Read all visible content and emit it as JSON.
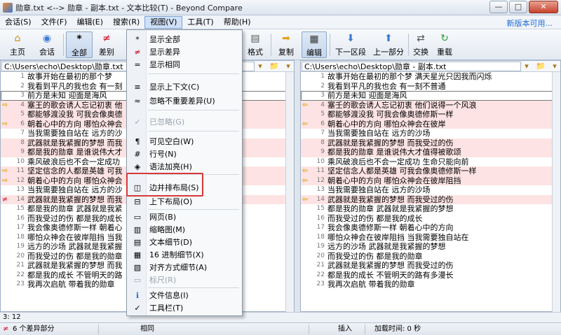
{
  "window": {
    "title": "勋章.txt <--> 勋章 - 副本.txt - 文本比较(T) - Beyond Compare",
    "min": "—",
    "max": "□",
    "close": "✕"
  },
  "menubar": {
    "items": [
      "会话(S)",
      "文件(F)",
      "编辑(E)",
      "搜索(R)",
      "视图(V)",
      "工具(T)",
      "帮助(H)"
    ],
    "new_version": "新版本可用..."
  },
  "toolbar": {
    "home": "主页",
    "session": "会话",
    "all": "全部",
    "diff": "差别",
    "format": "格式",
    "copy": "复制",
    "edit": "编辑",
    "next_section": "下一区段",
    "prev_part": "上一部分",
    "swap": "交换",
    "reload": "重载"
  },
  "left": {
    "path": "C:\\Users\\echo\\Desktop\\勋章.txt",
    "lines": [
      {
        "n": "1",
        "t": "故事开始在最初的那个梦",
        "g": "",
        "d": false
      },
      {
        "n": "2",
        "t": "我看到平凡的我也会  有一刻",
        "g": "",
        "d": false
      },
      {
        "n": "3",
        "t": "前方是未知  迎面是海风",
        "g": "",
        "d": false,
        "cur": true
      },
      {
        "n": "4",
        "t": "塞王的歌会诱人忘记初衷  他",
        "g": "⇨",
        "d": true
      },
      {
        "n": "5",
        "t": "都能够渡没我  可我会像奥德",
        "g": "",
        "d": true
      },
      {
        "n": "6",
        "t": "朝着心中的方向  哪怕众神会",
        "g": "⇨",
        "d": true
      },
      {
        "n": "7",
        "t": "当我需要独自站在  远方的沙",
        "g": "",
        "d": false
      },
      {
        "n": "8",
        "t": "武器就是我紧握的梦想  而我",
        "g": "",
        "d": true
      },
      {
        "n": "9",
        "t": "都是我的勋章  是谁说伟大才",
        "g": "",
        "d": true
      },
      {
        "n": "10",
        "t": "乘风破浪后也不会一定成功",
        "g": "",
        "d": false
      },
      {
        "n": "11",
        "t": "坚定信念的人都是英雄  可我",
        "g": "⇨",
        "d": true
      },
      {
        "n": "12",
        "t": "朝着心中的方向  哪怕众神会",
        "g": "⇨",
        "d": true
      },
      {
        "n": "13",
        "t": "当我需要独自站在  远方的沙",
        "g": "",
        "d": false
      },
      {
        "n": "14",
        "t": "武器就是我紧握的梦想  而我",
        "g": "≠",
        "d": true
      },
      {
        "n": "15",
        "t": "都是我的勋章  武器就是我紧",
        "g": "",
        "d": false
      },
      {
        "n": "16",
        "t": "而我受过的伤  都是我的成长",
        "g": "",
        "d": false
      },
      {
        "n": "17",
        "t": "我会像奥德修斯一样  朝着心",
        "g": "",
        "d": false
      },
      {
        "n": "18",
        "t": "哪怕众神会在彼岸阻挡  当我",
        "g": "",
        "d": false
      },
      {
        "n": "19",
        "t": "远方的沙场  武器就是我紧握",
        "g": "",
        "d": false
      },
      {
        "n": "20",
        "t": "而我受过的伤  都是我的勋章",
        "g": "",
        "d": false
      },
      {
        "n": "21",
        "t": "武器就是我紧握的梦想  而我",
        "g": "",
        "d": false
      },
      {
        "n": "22",
        "t": "都是我的成长  不管明天的路",
        "g": "",
        "d": false
      },
      {
        "n": "23",
        "t": "我再次启航  带着我的勋章",
        "g": "",
        "d": false
      }
    ]
  },
  "right": {
    "path": "C:\\Users\\echo\\Desktop\\勋章 - 副本.txt",
    "lines": [
      {
        "n": "1",
        "t": "故事开始在最初的那个梦  满天星光只因我而闪烁",
        "g": "",
        "d": false
      },
      {
        "n": "2",
        "t": "我看到平凡的我也会  有一刻不普通",
        "g": "",
        "d": false
      },
      {
        "n": "3",
        "t": "前方是未知  迎面是海风",
        "g": "",
        "d": false,
        "cur": true
      },
      {
        "n": "4",
        "t": "塞壬的歌会诱人忘记初衷  他们说得一个风浪",
        "g": "⇦",
        "d": true
      },
      {
        "n": "5",
        "t": "都能够渡没我  可我会像奥德修斯一样",
        "g": "",
        "d": true
      },
      {
        "n": "6",
        "t": "朝着心中的方向  哪怕众神会在彼岸",
        "g": "⇦",
        "d": true
      },
      {
        "n": "7",
        "t": "当我需要独自站在  远方的沙场",
        "g": "",
        "d": false
      },
      {
        "n": "8",
        "t": "武器就是我紧握的梦想  而我受过的伤",
        "g": "",
        "d": true
      },
      {
        "n": "9",
        "t": "都是我的勋章  是谁说伟大才值得被歌颂",
        "g": "",
        "d": true
      },
      {
        "n": "10",
        "t": "乘风破浪后也不会一定成功  生命只能向前",
        "g": "",
        "d": false
      },
      {
        "n": "11",
        "t": "坚定信念人都是英雄  可我会像奥德修斯一样",
        "g": "⇦",
        "d": true
      },
      {
        "n": "12",
        "t": "朝着心中的方向  哪怕众神会在彼岸阻挡",
        "g": "⇦",
        "d": true
      },
      {
        "n": "13",
        "t": "当我需要独自站在  远方的沙场",
        "g": "",
        "d": false
      },
      {
        "n": "14",
        "t": "武器就是我紧握的梦想  而我受过的伤",
        "g": "⇦",
        "d": true
      },
      {
        "n": "15",
        "t": "都是我的勋章  武器就是我紧握的梦想",
        "g": "",
        "d": false
      },
      {
        "n": "16",
        "t": "而我受过的伤  都是我的成长",
        "g": "",
        "d": false
      },
      {
        "n": "17",
        "t": "我会像奥德修斯一样  朝着心中的方向",
        "g": "",
        "d": false
      },
      {
        "n": "18",
        "t": "哪怕众神会在彼岸阻挡  当我需要独自站在",
        "g": "",
        "d": false
      },
      {
        "n": "19",
        "t": "远方的沙场  武器就是我紧握的梦想",
        "g": "",
        "d": false
      },
      {
        "n": "20",
        "t": "而我受过的伤  都是我的勋章",
        "g": "",
        "d": false
      },
      {
        "n": "21",
        "t": "武器就是我紧握的梦想  而我受过的伤",
        "g": "",
        "d": false
      },
      {
        "n": "22",
        "t": "都是我的成长  不管明天的路有多漫长",
        "g": "",
        "d": false
      },
      {
        "n": "23",
        "t": "我再次启航  带着我的勋章",
        "g": "",
        "d": false
      }
    ]
  },
  "view_menu": {
    "show_all": "显示全部",
    "show_diff": "显示差异",
    "show_same": "显示相同",
    "show_context": "显示上下文(C)",
    "ignore_unimportant": "忽略不重要差异(U)",
    "ignored": "已忽略(G)",
    "visible_whitespace": "可见空白(W)",
    "line_numbers": "行号(N)",
    "syntax_highlight": "语法加亮(H)",
    "side_by_side": "边并排布局(S)",
    "over_under": "上下布局(O)",
    "web_view": "网页(B)",
    "thumbnail": "缩略图(M)",
    "text_details": "文本细节(D)",
    "hex_details": "16 进制细节(X)",
    "aligned_details": "对齐方式细节(A)",
    "ruler": "标尺(R)",
    "file_info": "文件信息(I)",
    "toolbar": "工具栏(T)"
  },
  "pos": {
    "cursor": "3: 12",
    "cursor_right": "3: 12"
  },
  "status": {
    "diff_count": "6 个差异部分",
    "same": "相同",
    "mode": "插入",
    "load_time": "加载时间: 0 秒"
  }
}
